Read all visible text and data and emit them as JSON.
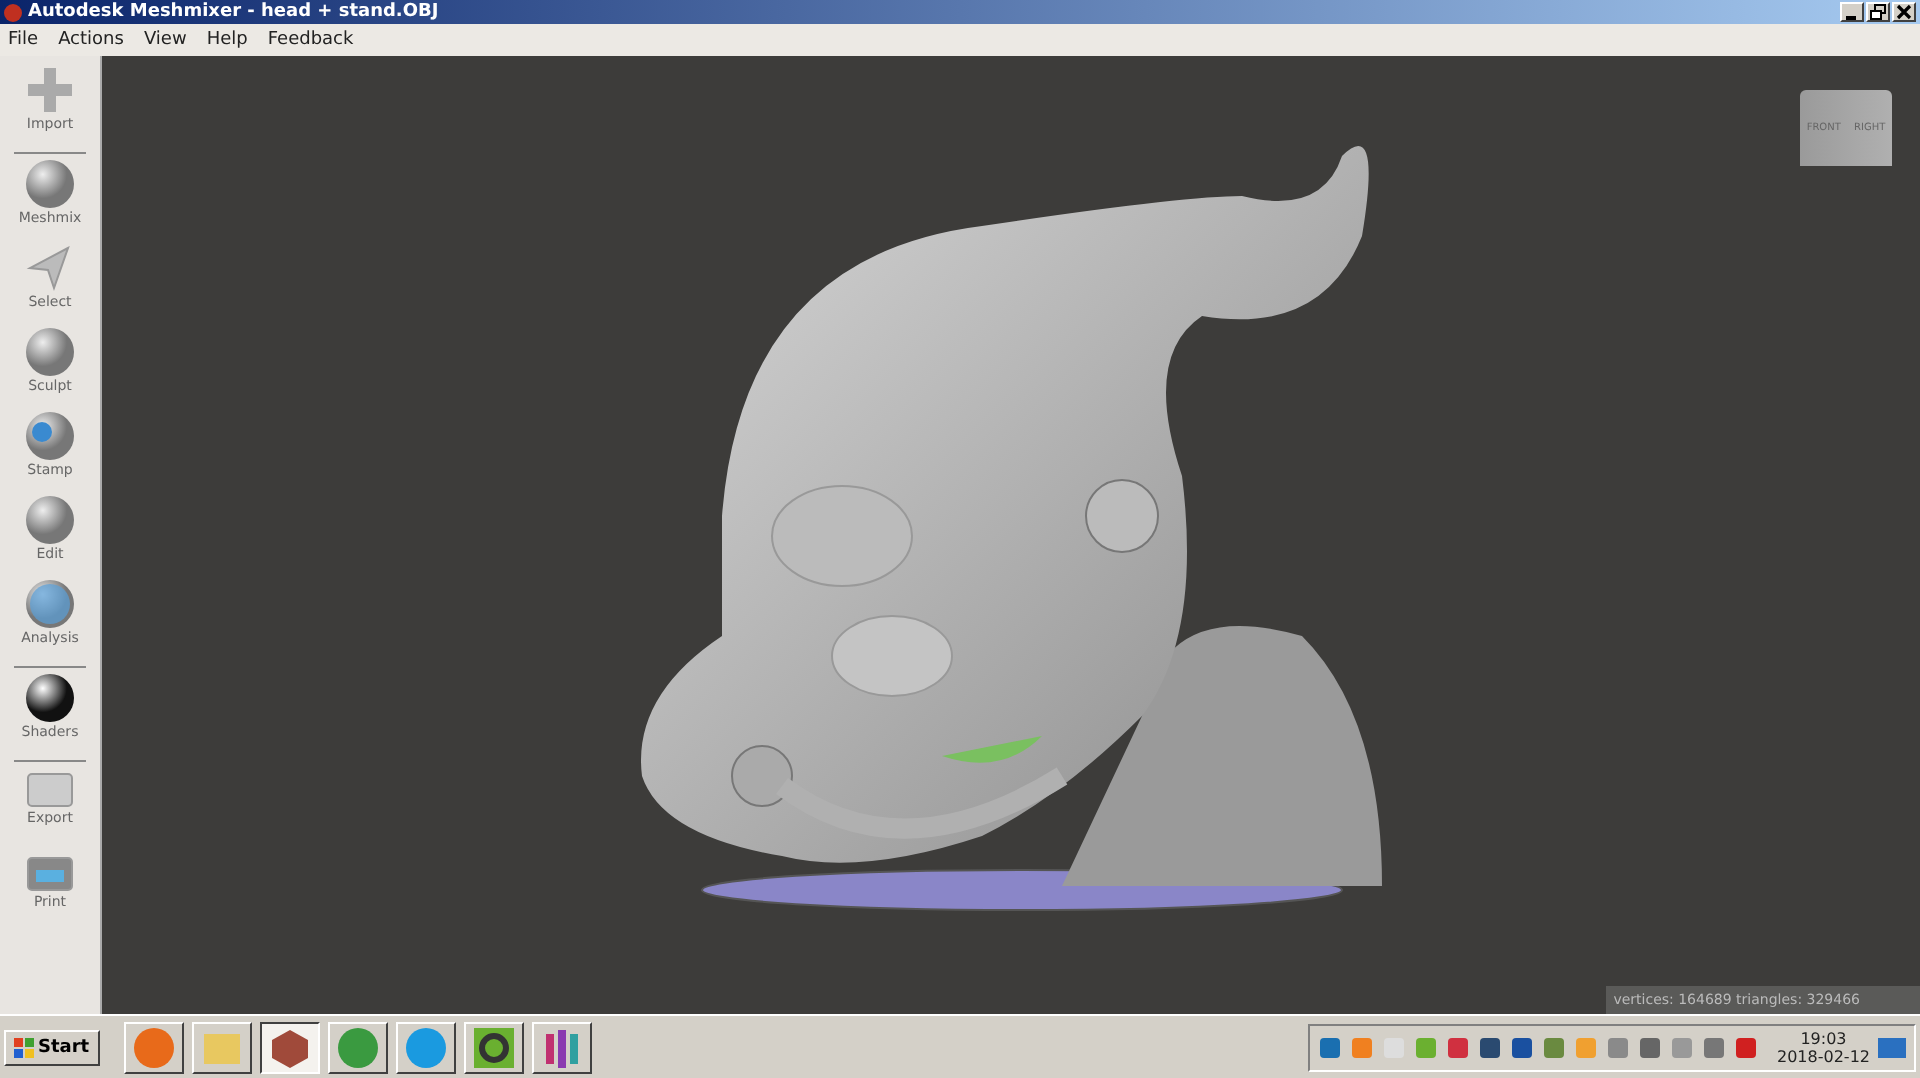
{
  "window": {
    "title": "Autodesk Meshmixer - head + stand.OBJ"
  },
  "menu": [
    "File",
    "Actions",
    "View",
    "Help",
    "Feedback"
  ],
  "tool_groups": [
    [
      "Import"
    ],
    [
      "Meshmix",
      "Select",
      "Sculpt",
      "Stamp",
      "Edit",
      "Analysis"
    ],
    [
      "Shaders"
    ],
    [
      "Export",
      "Print"
    ]
  ],
  "view_cube": {
    "faces": [
      "FRONT",
      "RIGHT"
    ]
  },
  "status": "vertices: 164689 triangles: 329466",
  "taskbar": {
    "start": "Start",
    "apps": [
      {
        "kind": "firefox",
        "selected": false
      },
      {
        "kind": "folder",
        "selected": false
      },
      {
        "kind": "meshmixer",
        "selected": true
      },
      {
        "kind": "chrome",
        "selected": false
      },
      {
        "kind": "skype",
        "selected": false
      },
      {
        "kind": "ring",
        "selected": false
      },
      {
        "kind": "bars",
        "selected": false
      }
    ],
    "time": "19:03",
    "date": "2018-02-12"
  }
}
